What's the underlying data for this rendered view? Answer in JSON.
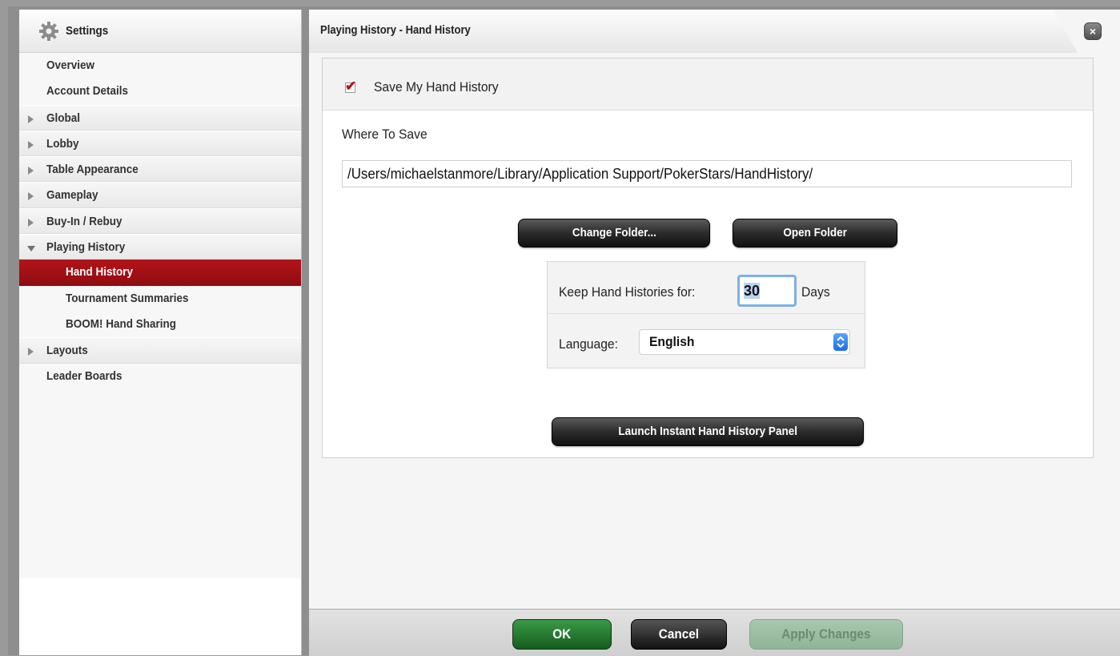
{
  "sidebar": {
    "title": "Settings",
    "items": [
      {
        "label": "Overview"
      },
      {
        "label": "Account Details"
      },
      {
        "label": "Global"
      },
      {
        "label": "Lobby"
      },
      {
        "label": "Table Appearance"
      },
      {
        "label": "Gameplay"
      },
      {
        "label": "Buy-In / Rebuy"
      },
      {
        "label": "Playing History"
      },
      {
        "label": "Hand History"
      },
      {
        "label": "Tournament Summaries"
      },
      {
        "label": "BOOM! Hand Sharing"
      },
      {
        "label": "Layouts"
      },
      {
        "label": "Leader Boards"
      }
    ]
  },
  "header": {
    "title": "Playing History - Hand History",
    "close_glyph": "×"
  },
  "hand_history": {
    "save_checkbox_label": "Save My Hand History",
    "save_checked": true,
    "check_glyph": "✔",
    "where_label": "Where To Save",
    "folder_path": "/Users/michaelstanmore/Library/Application Support/PokerStars/HandHistory/",
    "change_folder_label": "Change Folder...",
    "open_folder_label": "Open Folder",
    "keep_label": "Keep Hand Histories for:",
    "keep_days_value": "30",
    "days_label": "Days",
    "language_label": "Language:",
    "language_value": "English",
    "launch_panel_label": "Launch Instant Hand History Panel"
  },
  "footer": {
    "ok_label": "OK",
    "cancel_label": "Cancel",
    "apply_label": "Apply Changes"
  },
  "colors": {
    "active_nav": "#a3121a",
    "ok_green": "#1e7a2a",
    "apply_disabled": "#9fbfa4"
  },
  "icons": {
    "settings": "gear-icon",
    "close": "close-icon",
    "checkbox": "checkmark-icon",
    "language_stepper": "updown-chevron-icon"
  }
}
